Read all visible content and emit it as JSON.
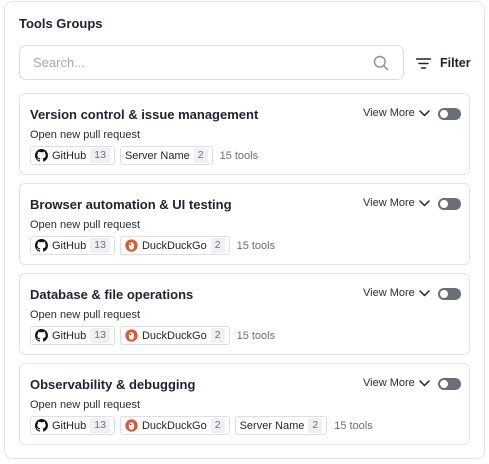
{
  "panel": {
    "title": "Tools Groups",
    "search": {
      "placeholder": "Search..."
    },
    "filter_label": "Filter"
  },
  "view_more_label": "View More",
  "groups": [
    {
      "title": "Version control & issue management",
      "subtitle": "Open new pull request",
      "enabled": false,
      "tags": [
        {
          "icon": "github-icon",
          "name": "GitHub",
          "count": "13"
        },
        {
          "icon": "",
          "name": "Server Name",
          "count": "2"
        }
      ],
      "tools_count": "15 tools"
    },
    {
      "title": "Browser automation & UI testing",
      "subtitle": "Open new pull request",
      "enabled": false,
      "tags": [
        {
          "icon": "github-icon",
          "name": "GitHub",
          "count": "13"
        },
        {
          "icon": "duckduckgo-icon",
          "name": "DuckDuckGo",
          "count": "2"
        }
      ],
      "tools_count": "15 tools"
    },
    {
      "title": "Database & file operations",
      "subtitle": "Open new pull request",
      "enabled": false,
      "tags": [
        {
          "icon": "github-icon",
          "name": "GitHub",
          "count": "13"
        },
        {
          "icon": "duckduckgo-icon",
          "name": "DuckDuckGo",
          "count": "2"
        }
      ],
      "tools_count": "15 tools"
    },
    {
      "title": "Observability & debugging",
      "subtitle": "Open new pull request",
      "enabled": false,
      "tags": [
        {
          "icon": "github-icon",
          "name": "GitHub",
          "count": "13"
        },
        {
          "icon": "duckduckgo-icon",
          "name": "DuckDuckGo",
          "count": "2"
        },
        {
          "icon": "",
          "name": "Server Name",
          "count": "2"
        }
      ],
      "tools_count": "15 tools"
    }
  ],
  "colors": {
    "toggle_off": "#6a6e79",
    "duckduckgo": "#de5833",
    "border": "#e2e4ea"
  }
}
